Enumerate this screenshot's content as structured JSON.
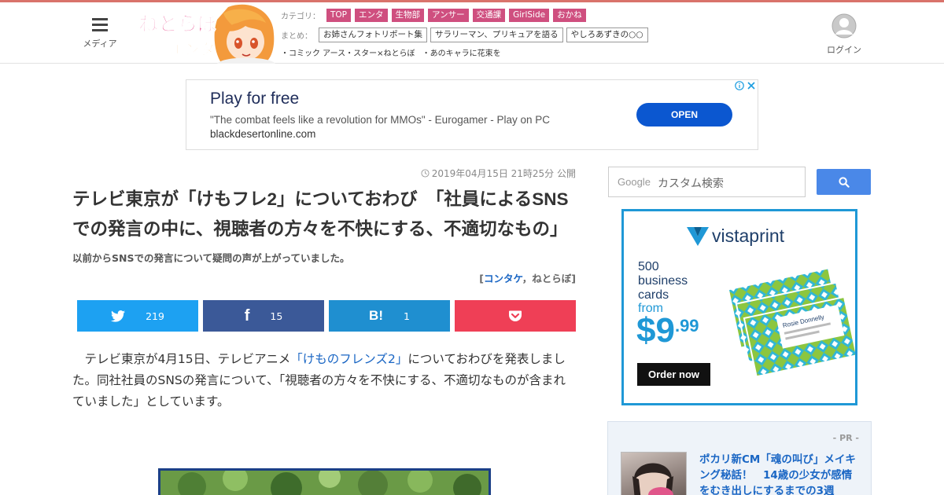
{
  "header": {
    "menu_label": "メディア",
    "logo_text_top": "ねとらぼ",
    "logo_text_bottom": "エンタ",
    "category_label": "カテゴリ：",
    "categories": [
      "TOP",
      "エンタ",
      "生物部",
      "アンサー",
      "交通課",
      "GirlSide",
      "おかね"
    ],
    "matome_label": "まとめ：",
    "matome_items": [
      "お姉さんフォトリポート集",
      "サラリーマン、プリキュアを語る",
      "やしろあずきの○○"
    ],
    "sub_links": [
      "・コミック アース・スター×ねとらぼ",
      "・あのキャラに花束を"
    ],
    "login_label": "ログイン"
  },
  "top_ad": {
    "title": "Play for free",
    "description": "\"The combat feels like a revolution for MMOs\" - Eurogamer - Play on PC",
    "url": "blackdesertonline.com",
    "button": "OPEN"
  },
  "article": {
    "published": "2019年04月15日 21時25分 公開",
    "title": "テレビ東京が「けもフレ2」についておわび　「社員によるSNSでの発言の中に、視聴者の方々を不快にする、不適切なもの」",
    "subtitle": "以前からSNSでの発言について疑問の声が上がっていました。",
    "credit_open": "[",
    "credit_author": "コンタケ",
    "credit_sep": "，",
    "credit_site": "ねとらぼ",
    "credit_close": "]",
    "share": {
      "twitter_count": "219",
      "facebook_count": "15",
      "hatena_mark": "B!",
      "hatena_count": "1"
    },
    "body_before": "　テレビ東京が4月15日、テレビアニメ",
    "body_link": "「けものフレンズ2」",
    "body_after": "についておわびを発表しました。同社社員のSNSの発言について、「視聴者の方々を不快にする、不適切なものが含まれていました」としています。"
  },
  "sidebar": {
    "search_brand": "Google",
    "search_placeholder": "カスタム検索",
    "ad": {
      "brand": "vistaprint",
      "offer_line1": "500",
      "offer_line2": "business",
      "offer_line3": "cards",
      "from": "from",
      "price_dollar": "$9",
      "price_cents": ".99",
      "cta": "Order now",
      "card_name": "Rosie Donnelly"
    },
    "pr": {
      "label": "- PR -",
      "headline": "ポカリ新CM「魂の叫び」メイキング秘話！　14歳の少女が感情をむき出しにするまでの3週"
    }
  },
  "colors": {
    "accent_line": "#d9736b",
    "category_bg": "#cf4f7f",
    "twitter": "#1da1f2",
    "facebook": "#3b5998",
    "hatena": "#1f8fd0",
    "pocket": "#ef3f56",
    "link": "#1a66c4"
  }
}
